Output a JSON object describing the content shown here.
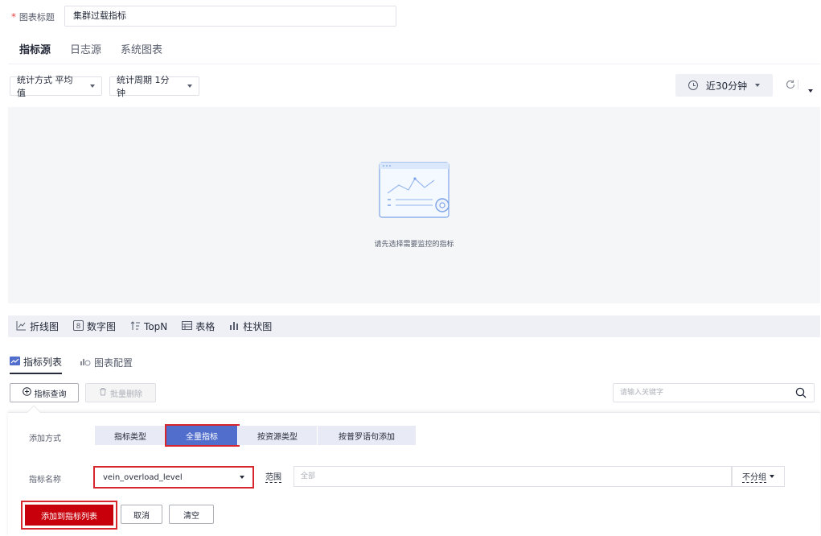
{
  "title_row": {
    "required_mark": "*",
    "label": "图表标题",
    "value": "集群过载指标"
  },
  "source_tabs": [
    {
      "label": "指标源",
      "active": true
    },
    {
      "label": "日志源",
      "active": false
    },
    {
      "label": "系统图表",
      "active": false
    }
  ],
  "filters": {
    "stat_method": "统计方式 平均值",
    "stat_period": "统计周期 1分钟"
  },
  "time_range": "近30分钟",
  "empty_state": "请先选择需要监控的指标",
  "chart_types": [
    {
      "icon": "line-chart-icon",
      "label": "折线图"
    },
    {
      "icon": "number-chart-icon",
      "label": "数字图"
    },
    {
      "icon": "topn-icon",
      "label": "TopN"
    },
    {
      "icon": "table-icon",
      "label": "表格"
    },
    {
      "icon": "bar-chart-icon",
      "label": "柱状图"
    }
  ],
  "metric_tabs": [
    {
      "label": "指标列表",
      "active": true
    },
    {
      "label": "图表配置",
      "active": false
    }
  ],
  "actions": {
    "query": "指标查询",
    "batch_delete": "批量删除",
    "search_placeholder": "请输入关键字"
  },
  "add_panel": {
    "mode_label": "添加方式",
    "modes": [
      {
        "label": "指标类型",
        "active": false
      },
      {
        "label": "全量指标",
        "active": true
      },
      {
        "label": "按资源类型",
        "active": false
      },
      {
        "label": "按普罗语句添加",
        "active": false
      }
    ],
    "name_label": "指标名称",
    "metric_value": "vein_overload_level",
    "range_label": "范围",
    "range_placeholder": "全部",
    "group_value": "不分组",
    "buttons": {
      "add": "添加到指标列表",
      "cancel": "取消",
      "clear": "清空"
    }
  },
  "colors": {
    "primary": "#c7000b",
    "accent": "#526ecc",
    "highlight": "#d7262e"
  }
}
